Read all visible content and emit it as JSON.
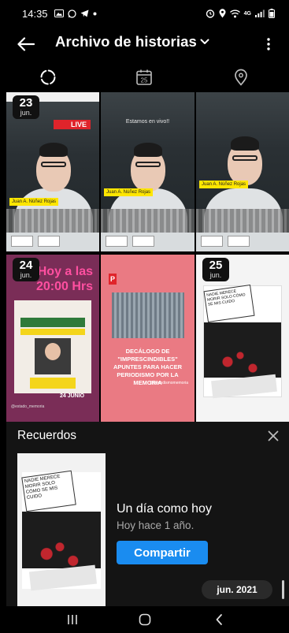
{
  "status_bar": {
    "time": "14:35",
    "network": "4G"
  },
  "header": {
    "title": "Archivo de historias"
  },
  "tabs": [
    {
      "name": "stories-tab",
      "icon": "dashed-circle-icon",
      "active": true
    },
    {
      "name": "calendar-tab",
      "icon": "calendar-icon",
      "label": "25"
    },
    {
      "name": "map-tab",
      "icon": "location-pin-icon"
    }
  ],
  "grid": {
    "cells": [
      {
        "badge_day": "23",
        "badge_month": "jun.",
        "name_tag": "Juan A. Núñez Rojas",
        "live": "LIVE"
      },
      {
        "overlay": "Estamos en vivo!!",
        "name_tag": "Juan A. Núñez Rojas"
      },
      {
        "name_tag": "Juan A. Núñez Rojas"
      },
      {
        "badge_day": "24",
        "badge_month": "jun.",
        "headline": "Hoy a las 20:00 Hrs",
        "date_line": "24 JUNIO",
        "handle": "@estado_memoria"
      },
      {
        "headline": "DECÁLOGO DE \"IMPRESCINDIBLES\" APUNTES PARA HACER PERIODISMO POR LA MEMORIA",
        "handle": "@periodismomemoria"
      },
      {
        "badge_day": "25",
        "badge_month": "jun.",
        "sign_text": "NADIE MERECE MORIR SOLO CÓMO SE MIS CUIDO"
      }
    ]
  },
  "recuerdos": {
    "title": "Recuerdos",
    "heading": "Un día como hoy",
    "subtitle": "Hoy hace 1 año.",
    "share_label": "Compartir",
    "date_pill": "jun. 2021",
    "sign_text": "NADIE MERECE MORIR SOLO CÓMO SE MIS CUIDO"
  },
  "colors": {
    "background": "#000000",
    "sheet": "#141414",
    "accent": "#1a8cf0"
  }
}
